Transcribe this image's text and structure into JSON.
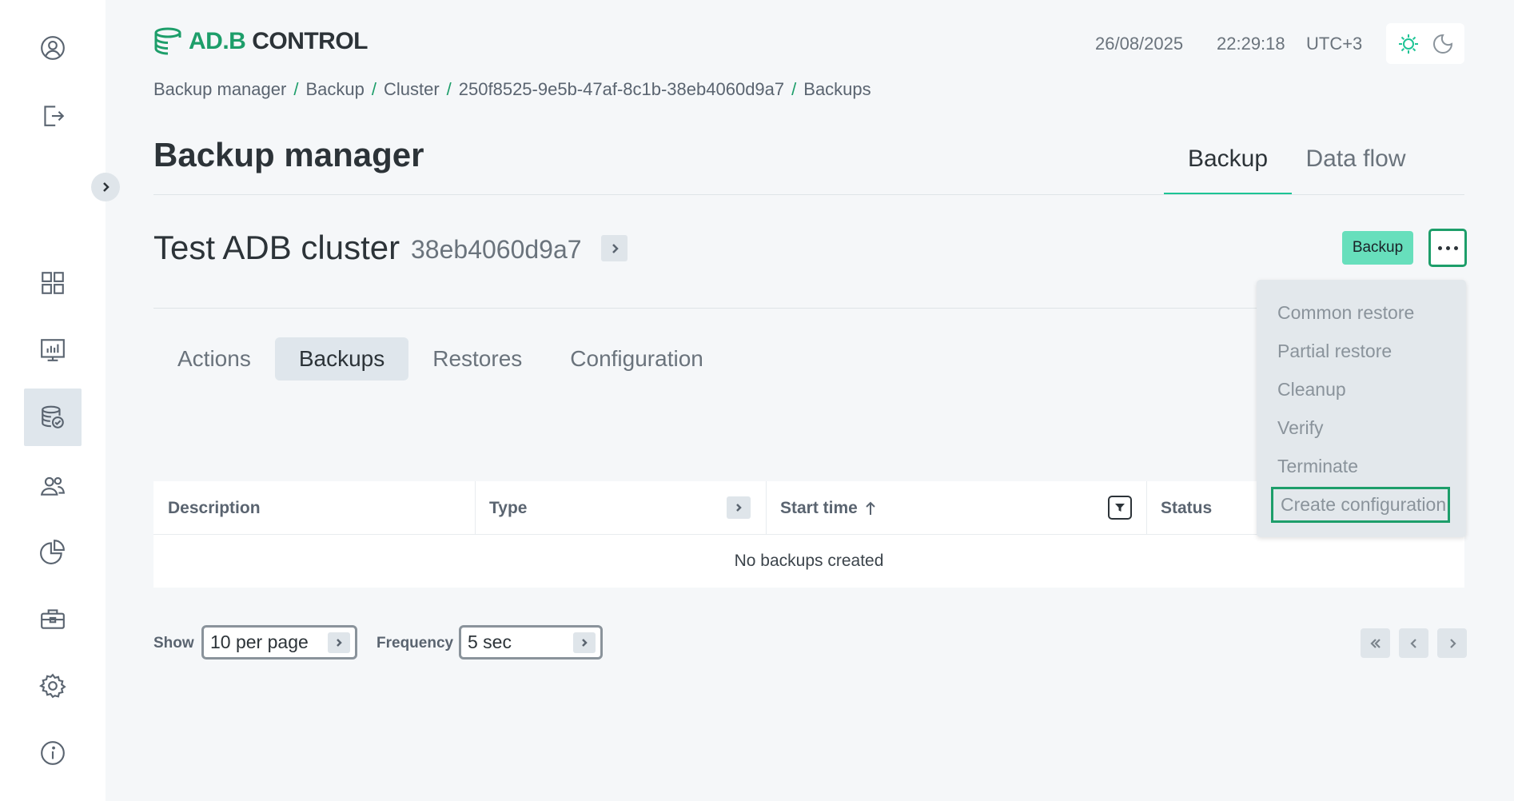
{
  "brand": {
    "logo_ad": "AD.B",
    "logo_control": "CONTROL",
    "accent": "#1dc495"
  },
  "header": {
    "date": "26/08/2025",
    "time": "22:29:18",
    "timezone": "UTC+3"
  },
  "breadcrumb": [
    "Backup manager",
    "Backup",
    "Cluster",
    "250f8525-9e5b-47af-8c1b-38eb4060d9a7",
    "Backups"
  ],
  "page": {
    "title": "Backup manager",
    "tabs": [
      "Backup",
      "Data flow"
    ],
    "active_tab": "Backup"
  },
  "cluster": {
    "name": "Test ADB cluster",
    "id_short": "38eb4060d9a7",
    "backup_button": "Backup"
  },
  "subtabs": [
    "Actions",
    "Backups",
    "Restores",
    "Configuration"
  ],
  "active_subtab": "Backups",
  "table": {
    "columns": [
      "Description",
      "Type",
      "Start time",
      "Status"
    ],
    "empty_message": "No backups created"
  },
  "pagination": {
    "show_label": "Show",
    "per_page": "10 per page",
    "frequency_label": "Frequency",
    "frequency": "5 sec"
  },
  "menu": {
    "items": [
      "Common restore",
      "Partial restore",
      "Cleanup",
      "Verify",
      "Terminate",
      "Create configuration"
    ],
    "focused": "Create configuration"
  },
  "sidebar_icons": [
    "user-icon",
    "logout-icon",
    "dashboard-icon",
    "monitoring-icon",
    "backup-db-icon",
    "users-icon",
    "reports-icon",
    "tools-icon",
    "settings-icon",
    "info-icon"
  ]
}
